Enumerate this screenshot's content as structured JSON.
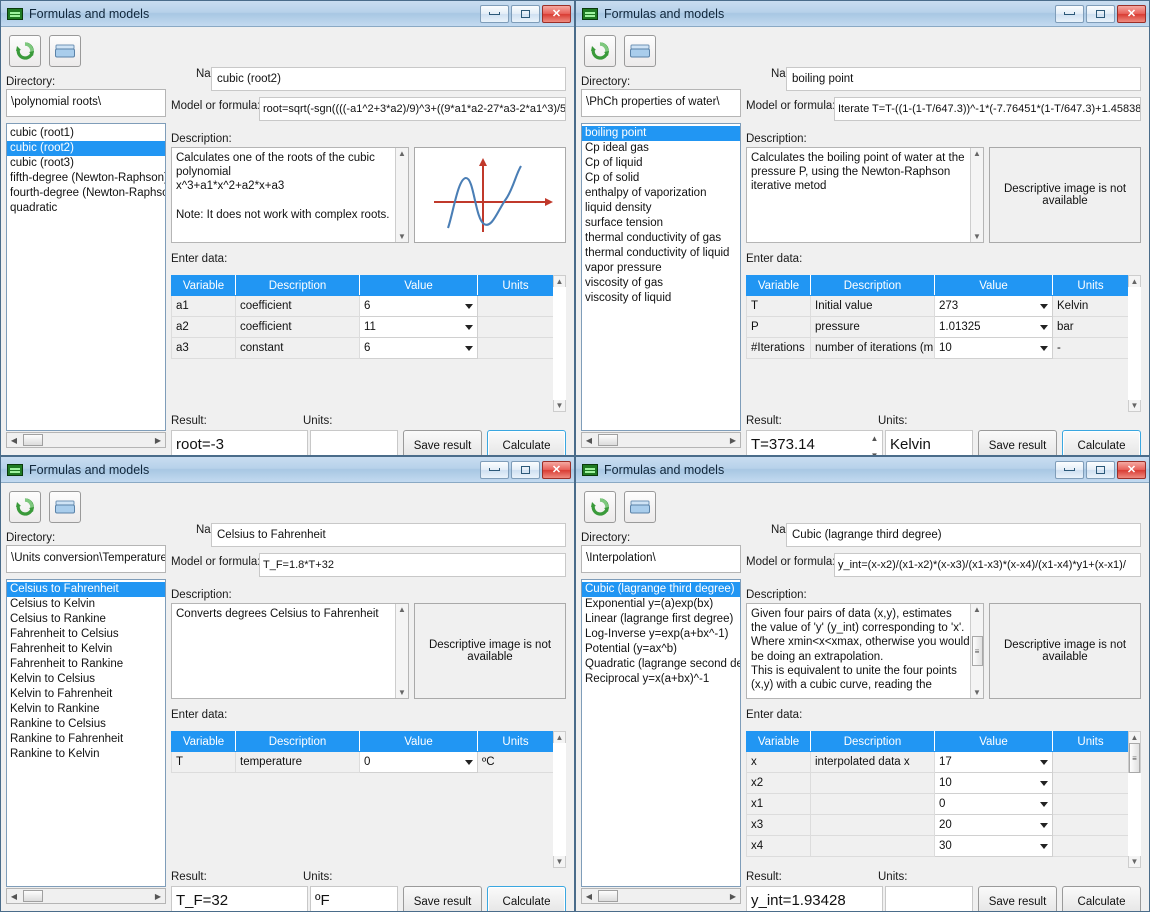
{
  "window_title": "Formulas and models",
  "labels": {
    "directory": "Directory:",
    "name": "Name:",
    "model_or_formula": "Model or formula:",
    "description": "Description:",
    "enter_data": "Enter data:",
    "result": "Result:",
    "units": "Units:",
    "save_result": "Save result",
    "calculate": "Calculate",
    "no_image": "Descriptive image is not available"
  },
  "table_headers": [
    "Variable",
    "Description",
    "Value",
    "Units"
  ],
  "colors": {
    "header_blue": "#2196f3",
    "selection_blue": "#2196f3",
    "titlebar_blue": "#b7d1ea",
    "close_red": "#d93c33",
    "curve_blue": "#4a7eb5",
    "axis_red": "#c0392b"
  },
  "windows": [
    {
      "id": "polynomial-roots",
      "directory": "\\polynomial roots\\",
      "list": [
        "cubic (root1)",
        "cubic (root2)",
        "cubic (root3)",
        "fifth-degree (Newton-Raphson)",
        "fourth-degree (Newton-Raphson)",
        "quadratic"
      ],
      "selected_index": 1,
      "name": "cubic (root2)",
      "formula": "root=sqrt(-sgn((((-a1^2+3*a2)/9)^3+((9*a1*a2-27*a3-2*a1^3)/5",
      "description_lines": [
        "Calculates one of the roots of the cubic",
        "polynomial",
        "x^3+a1*x^2+a2*x+a3",
        "",
        "Note: It does not work with complex roots."
      ],
      "has_image": true,
      "rows": [
        {
          "variable": "a1",
          "description": "coefficient",
          "value": "6",
          "units": ""
        },
        {
          "variable": "a2",
          "description": "coefficient",
          "value": "11",
          "units": ""
        },
        {
          "variable": "a3",
          "description": "constant",
          "value": "6",
          "units": ""
        }
      ],
      "result": "root=-3",
      "result_units": "",
      "result_has_spinner": false,
      "calculate_focused": true,
      "table_scroll_thumb": false
    },
    {
      "id": "water-properties",
      "directory": "\\PhCh properties of water\\",
      "list": [
        "boiling point",
        "Cp ideal gas",
        "Cp of liquid",
        "Cp of solid",
        "enthalpy of vaporization",
        "liquid density",
        "surface tension",
        "thermal conductivity of gas",
        "thermal conductivity of liquid",
        "vapor pressure",
        "viscosity of gas",
        "viscosity of liquid"
      ],
      "selected_index": 0,
      "name": "boiling point",
      "formula": "Iterate T=T-((1-(1-T/647.3))^-1*(-7.76451*(1-T/647.3)+1.45838",
      "description_lines": [
        "Calculates the boiling point of water at the",
        "pressure P, using the Newton-Raphson",
        "iterative metod"
      ],
      "has_image": false,
      "rows": [
        {
          "variable": "T",
          "description": "Initial value",
          "value": "273",
          "units": "Kelvin"
        },
        {
          "variable": "P",
          "description": "pressure",
          "value": "1.01325",
          "units": "bar"
        },
        {
          "variable": "#Iterations",
          "description": "number of iterations (mi",
          "value": "10",
          "units": "-"
        }
      ],
      "result": "T=373.14",
      "result_units": "Kelvin",
      "result_has_spinner": true,
      "calculate_focused": true,
      "table_scroll_thumb": false
    },
    {
      "id": "temperature-conversion",
      "directory": "\\Units conversion\\Temperature",
      "list": [
        "Celsius to Fahrenheit",
        "Celsius to Kelvin",
        "Celsius to Rankine",
        "Fahrenheit to Celsius",
        "Fahrenheit to Kelvin",
        "Fahrenheit to Rankine",
        "Kelvin to Celsius",
        "Kelvin to Fahrenheit",
        "Kelvin to Rankine",
        "Rankine to Celsius",
        "Rankine to Fahrenheit",
        "Rankine to Kelvin"
      ],
      "selected_index": 0,
      "name": "Celsius to Fahrenheit",
      "formula": "T_F=1.8*T+32",
      "description_lines": [
        "Converts degrees Celsius to Fahrenheit"
      ],
      "has_image": false,
      "rows": [
        {
          "variable": "T",
          "description": "temperature",
          "value": "0",
          "units": "ºC"
        }
      ],
      "result": "T_F=32",
      "result_units": "ºF",
      "result_has_spinner": false,
      "calculate_focused": true,
      "table_scroll_thumb": false
    },
    {
      "id": "interpolation",
      "directory": "\\Interpolation\\",
      "list": [
        "Cubic (lagrange third degree)",
        "Exponential y=(a)exp(bx)",
        "Linear (lagrange first degree)",
        "Log-Inverse y=exp(a+bx^-1)",
        "Potential (y=ax^b)",
        "Quadratic (lagrange second de",
        "Reciprocal y=x(a+bx)^-1"
      ],
      "selected_index": 0,
      "name": "Cubic (lagrange third degree)",
      "formula": "y_int=(x-x2)/(x1-x2)*(x-x3)/(x1-x3)*(x-x4)/(x1-x4)*y1+(x-x1)/",
      "description_lines": [
        "Given four pairs of data (x,y), estimates",
        "the value of 'y' (y_int) corresponding to 'x'.",
        "Where xmin<x<xmax, otherwise you would",
        "be doing an extrapolation.",
        "This is equivalent to unite the four points",
        "(x,y) with a cubic curve, reading the"
      ],
      "description_has_thumb": true,
      "has_image": false,
      "rows": [
        {
          "variable": "x",
          "description": "interpolated data x",
          "value": "17",
          "units": ""
        },
        {
          "variable": "x2",
          "description": "",
          "value": "10",
          "units": ""
        },
        {
          "variable": "x1",
          "description": "",
          "value": "0",
          "units": ""
        },
        {
          "variable": "x3",
          "description": "",
          "value": "20",
          "units": ""
        },
        {
          "variable": "x4",
          "description": "",
          "value": "30",
          "units": ""
        }
      ],
      "result": "y_int=1.93428",
      "result_units": "",
      "result_has_spinner": false,
      "calculate_focused": false,
      "table_scroll_thumb": true
    }
  ]
}
